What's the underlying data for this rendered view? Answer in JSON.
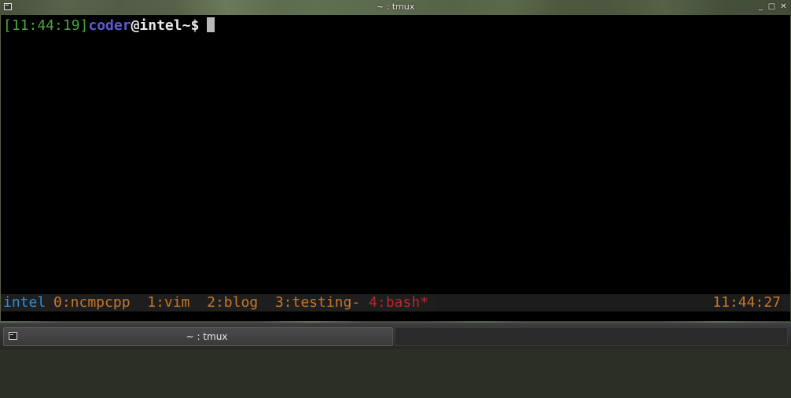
{
  "window": {
    "title": "~ : tmux",
    "controls": {
      "minimize": "_",
      "maximize": "□",
      "close": "✕"
    }
  },
  "terminal": {
    "prompt": {
      "time": "[11:44:19]",
      "user": "coder",
      "at": "@",
      "host": "intel",
      "path": "~",
      "symbol": "$"
    }
  },
  "tmux": {
    "session": "intel",
    "windows": [
      {
        "label": "0:ncmpcpp",
        "active": false
      },
      {
        "label": "1:vim",
        "active": false
      },
      {
        "label": "2:blog",
        "active": false
      },
      {
        "label": "3:testing-",
        "active": false
      },
      {
        "label": "4:bash*",
        "active": true
      }
    ],
    "clock": "11:44:27",
    "colors": {
      "session": "#2f8fd8",
      "window": "#c7772a",
      "active_window": "#c0262b",
      "clock": "#c7772a"
    }
  },
  "taskbar": {
    "tasks": [
      {
        "label": "~ : tmux",
        "icon": "terminal-icon"
      }
    ]
  }
}
